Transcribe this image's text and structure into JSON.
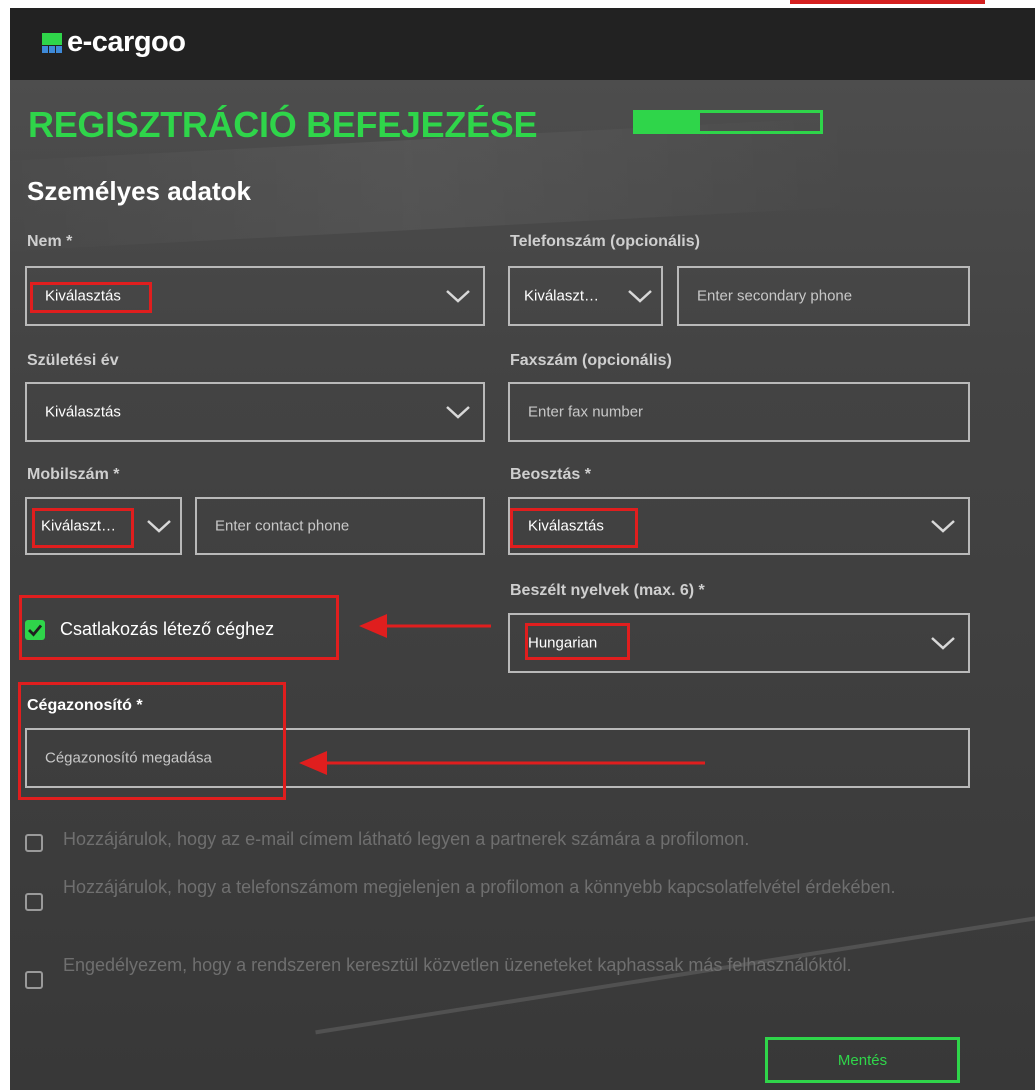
{
  "header": {
    "logo_text": "e-cargoo"
  },
  "page": {
    "title": "REGISZTRÁCIÓ BEFEJEZÉSE",
    "progress_fraction": 0.35,
    "section_title": "Személyes adatok"
  },
  "form": {
    "gender": {
      "label": "Nem *",
      "value": "Kiválasztás"
    },
    "birth_year": {
      "label": "Születési év",
      "value": "Kiválasztás"
    },
    "mobile": {
      "label": "Mobilszám *",
      "country_value": "Kiválaszt…",
      "placeholder": "Enter contact phone"
    },
    "phone": {
      "label": "Telefonszám (opcionális)",
      "country_value": "Kiválaszt…",
      "placeholder": "Enter secondary phone"
    },
    "fax": {
      "label": "Faxszám (opcionális)",
      "placeholder": "Enter fax number"
    },
    "position": {
      "label": "Beosztás *",
      "value": "Kiválasztás"
    },
    "languages": {
      "label": "Beszélt nyelvek (max. 6) *",
      "value": "Hungarian"
    },
    "join_company": {
      "label": "Csatlakozás létező céghez",
      "checked": true
    },
    "company_id": {
      "label": "Cégazonosító *",
      "placeholder": "Cégazonosító megadása"
    }
  },
  "consents": [
    {
      "text": "Hozzájárulok, hogy az e-mail címem látható legyen a partnerek számára a profilomon.",
      "checked": false
    },
    {
      "text": "Hozzájárulok, hogy a telefonszámom megjelenjen a profilomon a könnyebb kapcsolatfelvétel érdekében.",
      "checked": false
    },
    {
      "text": "Engedélyezem, hogy a rendszeren keresztül közvetlen üzeneteket kaphassak más felhasználóktól.",
      "checked": false
    }
  ],
  "actions": {
    "save_label": "Mentés"
  },
  "colors": {
    "accent": "#2fd54a",
    "annotation": "#e01e1e",
    "background": "#444444"
  }
}
